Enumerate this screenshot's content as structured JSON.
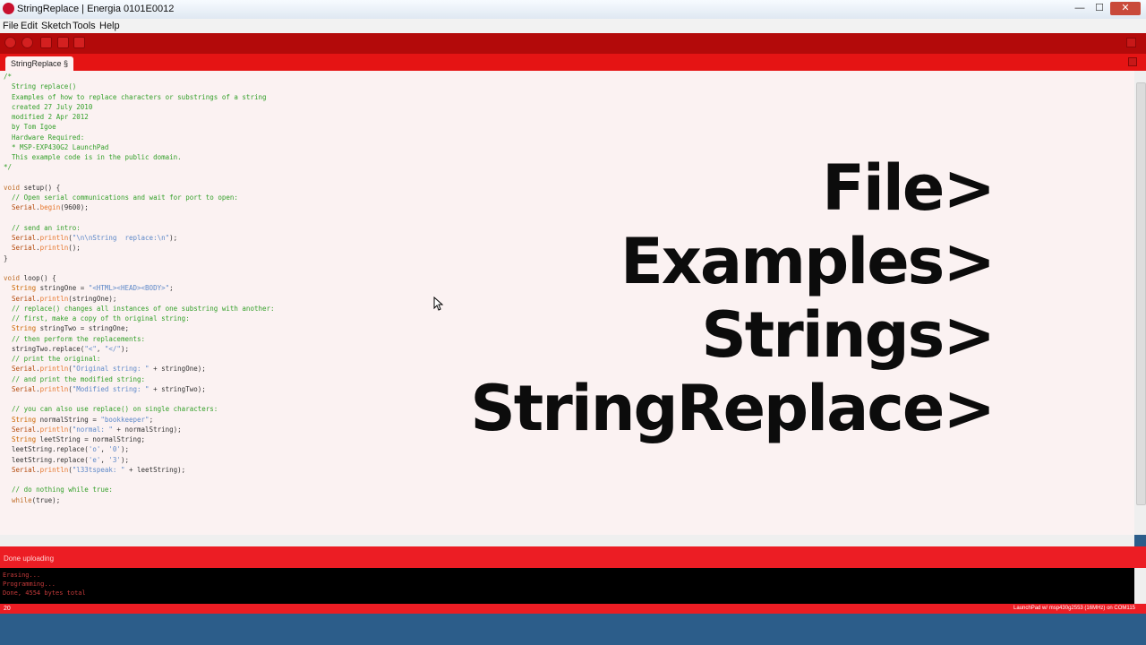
{
  "window": {
    "title": "StringReplace | Energia 0101E0012",
    "min": "—",
    "max": "☐",
    "close": "✕"
  },
  "menu": {
    "file": "File",
    "edit": "Edit",
    "sketch": "Sketch",
    "tools": "Tools",
    "help": "Help"
  },
  "tabs": {
    "active": "StringReplace §"
  },
  "overlay": {
    "l1": "File>",
    "l2": "Examples>",
    "l3": "Strings>",
    "l4": "StringReplace>"
  },
  "code": [
    "/*",
    "  String replace()",
    "  Examples of how to replace characters or substrings of a string",
    "",
    "  created 27 July 2010",
    "  modified 2 Apr 2012",
    "  by Tom Igoe",
    "",
    "  Hardware Required:",
    "  * MSP-EXP430G2 LaunchPad",
    "",
    "  This example code is in the public domain.",
    "*/",
    "",
    "void setup() {",
    "  // Open serial communications and wait for port to open:",
    "  Serial.begin(9600);",
    "",
    "  // send an intro:",
    "  Serial.println(\"\\n\\nString  replace:\\n\");",
    "  Serial.println();",
    "}",
    "",
    "void loop() {",
    "  String stringOne = \"<HTML><HEAD><BODY>\";",
    "  Serial.println(stringOne);",
    "  // replace() changes all instances of one substring with another:",
    "  // first, make a copy of th original string:",
    "  String stringTwo = stringOne;",
    "  // then perform the replacements:",
    "  stringTwo.replace(\"<\", \"</\");",
    "  // print the original:",
    "  Serial.println(\"Original string: \" + stringOne);",
    "  // and print the modified string:",
    "  Serial.println(\"Modified string: \" + stringTwo);",
    "",
    "  // you can also use replace() on single characters:",
    "  String normalString = \"bookkeeper\";",
    "  Serial.println(\"normal: \" + normalString);",
    "  String leetString = normalString;",
    "  leetString.replace('o', '0');",
    "  leetString.replace('e', '3');",
    "  Serial.println(\"l33tspeak: \" + leetString);",
    "",
    "  // do nothing while true:",
    "  while(true);"
  ],
  "status": {
    "text": "Done uploading"
  },
  "console": {
    "lines": "Erasing...\nProgramming...\nDone, 4554 bytes total"
  },
  "footer": {
    "line": "20",
    "board": "LaunchPad w/ msp430g2553 (16MHz) on COM115"
  },
  "colors": {
    "toolbar": "#b30a0a",
    "tabbar": "#e51414",
    "status": "#ec1d24",
    "editor_bg": "#fbf2f2"
  },
  "icons": [
    "verify-icon",
    "upload-icon",
    "new-icon",
    "open-icon",
    "save-icon",
    "serial-monitor-icon",
    "tab-menu-icon",
    "mouse-cursor-icon"
  ]
}
